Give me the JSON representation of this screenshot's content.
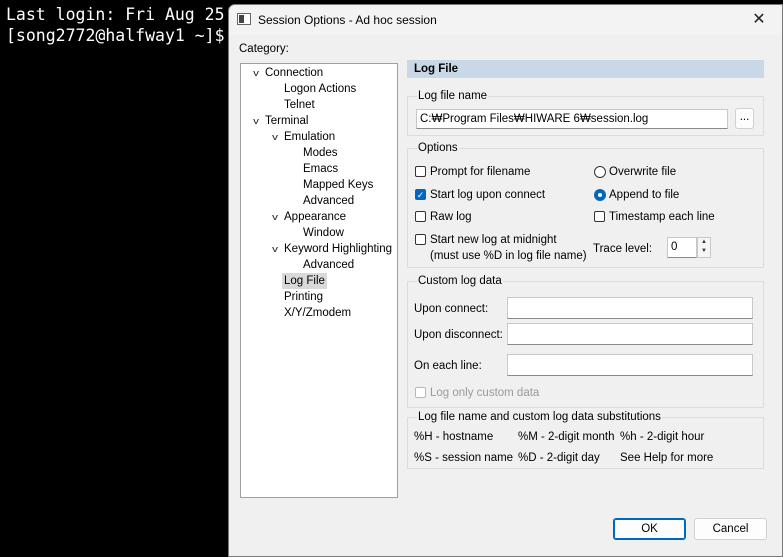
{
  "terminal": {
    "line1": "Last login: Fri Aug 25",
    "line2": "[song2772@halfway1 ~]$"
  },
  "dialog": {
    "title": "Session Options - Ad hoc session",
    "close_glyph": "✕",
    "category_label": "Category:"
  },
  "tree": [
    {
      "label": "Connection",
      "level": 0,
      "expanded": true
    },
    {
      "label": "Logon Actions",
      "level": 1
    },
    {
      "label": "Telnet",
      "level": 1
    },
    {
      "label": "Terminal",
      "level": 0,
      "expanded": true
    },
    {
      "label": "Emulation",
      "level": 1,
      "expanded": true
    },
    {
      "label": "Modes",
      "level": 2
    },
    {
      "label": "Emacs",
      "level": 2
    },
    {
      "label": "Mapped Keys",
      "level": 2
    },
    {
      "label": "Advanced",
      "level": 2
    },
    {
      "label": "Appearance",
      "level": 1,
      "expanded": true
    },
    {
      "label": "Window",
      "level": 2
    },
    {
      "label": "Keyword Highlighting",
      "level": 1,
      "expanded": true
    },
    {
      "label": "Advanced",
      "level": 2
    },
    {
      "label": "Log File",
      "level": 1,
      "selected": true
    },
    {
      "label": "Printing",
      "level": 1
    },
    {
      "label": "X/Y/Zmodem",
      "level": 1
    }
  ],
  "panel": {
    "header": "Log File",
    "log_file_name": {
      "group_title": "Log file name",
      "value": "C:₩Program Files₩HIWARE 6₩session.log",
      "browse_label": "..."
    },
    "options": {
      "group_title": "Options",
      "prompt_for_filename": {
        "label": "Prompt for filename",
        "checked": false
      },
      "start_log_upon_connect": {
        "label": "Start log upon connect",
        "checked": true
      },
      "raw_log": {
        "label": "Raw log",
        "checked": false
      },
      "start_new_log": {
        "label": "Start new log at midnight",
        "sublabel": "(must use %D in log file name)",
        "checked": false
      },
      "overwrite_file": {
        "label": "Overwrite file",
        "selected": false
      },
      "append_to_file": {
        "label": "Append to file",
        "selected": true
      },
      "timestamp_each_line": {
        "label": "Timestamp each line",
        "checked": false
      },
      "trace_level": {
        "label": "Trace level:",
        "value": "0"
      }
    },
    "custom_log_data": {
      "group_title": "Custom log data",
      "upon_connect": {
        "label": "Upon connect:",
        "value": ""
      },
      "upon_disconnect": {
        "label": "Upon disconnect:",
        "value": ""
      },
      "on_each_line": {
        "label": "On each line:",
        "value": ""
      },
      "log_only_custom": {
        "label": "Log only custom data",
        "checked": false,
        "disabled": true
      }
    },
    "substitutions": {
      "group_title": "Log file name and custom log data substitutions",
      "row1": [
        "%H - hostname",
        "%M - 2-digit month",
        "%h - 2-digit hour"
      ],
      "row2": [
        "%S - session name",
        "%D - 2-digit day",
        "See Help for more"
      ]
    }
  },
  "buttons": {
    "ok": "OK",
    "cancel": "Cancel"
  },
  "colors": {
    "accent": "#0067c0",
    "header_bar": "#c9d8e6",
    "dialog_bg": "#f0f0f0",
    "terminal_bg": "#000000"
  }
}
